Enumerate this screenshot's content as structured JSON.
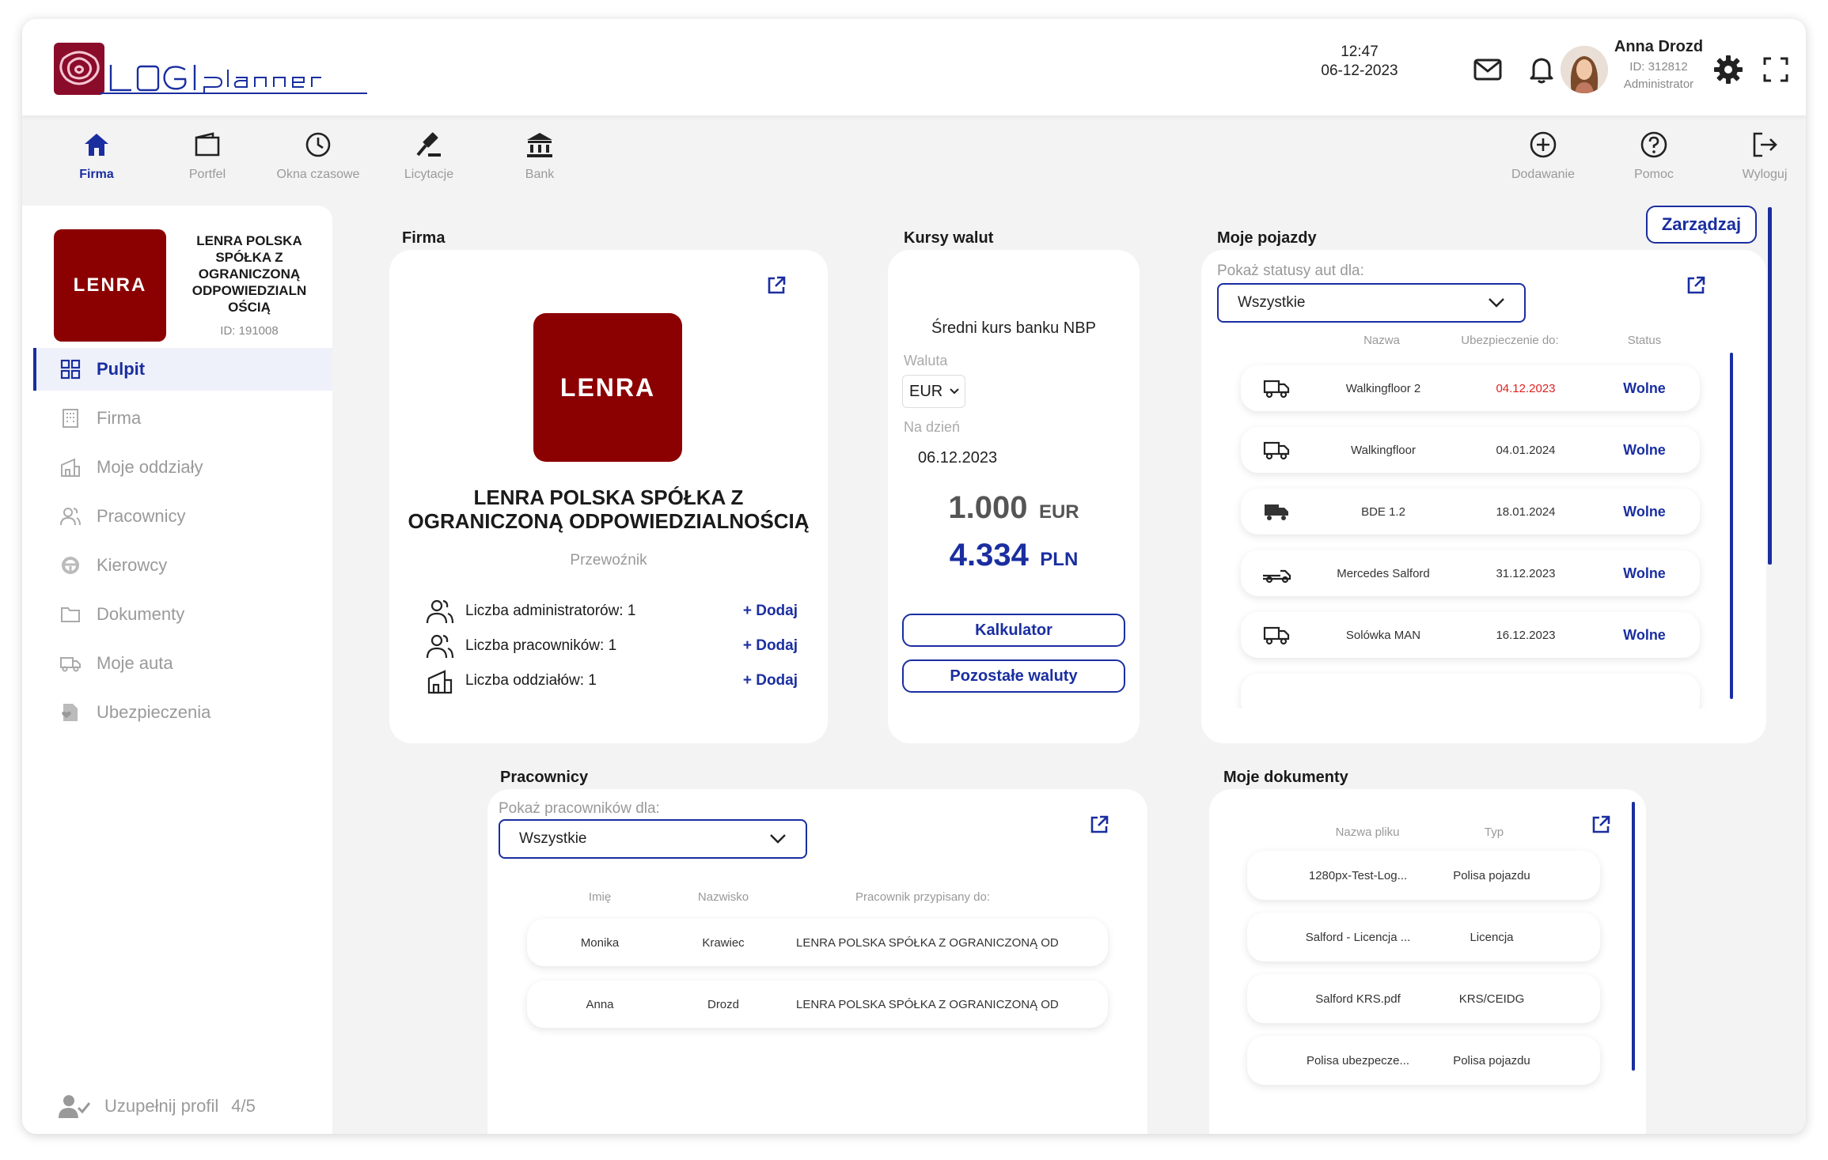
{
  "header": {
    "time": "12:47",
    "date": "06-12-2023",
    "user": {
      "name": "Anna Drozd",
      "id": "ID: 312812",
      "role": "Administrator"
    }
  },
  "nav": {
    "left": [
      {
        "label": "Firma",
        "icon": "home-icon",
        "active": true
      },
      {
        "label": "Portfel",
        "icon": "wallet-icon"
      },
      {
        "label": "Okna czasowe",
        "icon": "clock-icon"
      },
      {
        "label": "Licytacje",
        "icon": "gavel-icon"
      },
      {
        "label": "Bank",
        "icon": "bank-icon"
      }
    ],
    "right": [
      {
        "label": "Dodawanie",
        "icon": "plus-circle-icon"
      },
      {
        "label": "Pomoc",
        "icon": "help-icon"
      },
      {
        "label": "Wyloguj",
        "icon": "logout-icon"
      }
    ]
  },
  "sidebar": {
    "logo_text": "LENRA",
    "company_name": "LENRA POLSKA SPÓŁKA Z OGRANICZONĄ ODPOWIEDZIALN OŚCIĄ",
    "company_id": "ID: 191008",
    "items": [
      {
        "label": "Pulpit",
        "icon": "dashboard-icon",
        "active": true
      },
      {
        "label": "Firma",
        "icon": "building-icon"
      },
      {
        "label": "Moje oddziały",
        "icon": "branch-icon"
      },
      {
        "label": "Pracownicy",
        "icon": "users-icon"
      },
      {
        "label": "Kierowcy",
        "icon": "steering-wheel-icon"
      },
      {
        "label": "Dokumenty",
        "icon": "folder-icon"
      },
      {
        "label": "Moje auta",
        "icon": "truck-icon"
      },
      {
        "label": "Ubezpieczenia",
        "icon": "insurance-icon"
      }
    ],
    "complete_profile": "Uzupełnij profil",
    "profile_progress": "4/5"
  },
  "firma": {
    "title": "Firma",
    "logo_text": "LENRA",
    "name": "LENRA POLSKA SPÓŁKA Z OGRANICZONĄ ODPOWIEDZIALNOŚCIĄ",
    "type": "Przewoźnik",
    "stats": [
      {
        "label": "Liczba administratorów: 1",
        "action": "+ Dodaj"
      },
      {
        "label": "Liczba pracowników: 1",
        "action": "+ Dodaj"
      },
      {
        "label": "Liczba oddziałów: 1",
        "action": "+ Dodaj"
      }
    ]
  },
  "kursy": {
    "title": "Kursy walut",
    "subtitle": "Średni kurs banku NBP",
    "currency_label": "Waluta",
    "currency": "EUR",
    "date_label": "Na dzień",
    "date": "06.12.2023",
    "amount": "1.000",
    "amount_unit": "EUR",
    "result": "4.334",
    "result_unit": "PLN",
    "calc_btn": "Kalkulator",
    "other_btn": "Pozostałe waluty"
  },
  "pojazdy": {
    "title": "Moje pojazdy",
    "manage_btn": "Zarządzaj",
    "filter_label": "Pokaż statusy aut dla:",
    "filter_value": "Wszystkie",
    "columns": [
      "Nazwa",
      "Ubezpieczenie do:",
      "Status"
    ],
    "rows": [
      {
        "name": "Walkingfloor 2",
        "insurance": "04.12.2023",
        "status": "Wolne",
        "icon": "truck-icon",
        "expired": true
      },
      {
        "name": "Walkingfloor",
        "insurance": "04.01.2024",
        "status": "Wolne",
        "icon": "truck-icon"
      },
      {
        "name": "BDE 1.2",
        "insurance": "18.01.2024",
        "status": "Wolne",
        "icon": "truck-filled-icon"
      },
      {
        "name": "Mercedes Salford",
        "insurance": "31.12.2023",
        "status": "Wolne",
        "icon": "trailer-icon"
      },
      {
        "name": "Solówka MAN",
        "insurance": "16.12.2023",
        "status": "Wolne",
        "icon": "truck-icon"
      }
    ]
  },
  "pracownicy": {
    "title": "Pracownicy",
    "filter_label": "Pokaż pracowników dla:",
    "filter_value": "Wszystkie",
    "columns": [
      "Imię",
      "Nazwisko",
      "Pracownik przypisany do:"
    ],
    "rows": [
      {
        "first": "Monika",
        "last": "Krawiec",
        "assigned": "LENRA POLSKA SPÓŁKA Z OGRANICZONĄ OD"
      },
      {
        "first": "Anna",
        "last": "Drozd",
        "assigned": "LENRA POLSKA SPÓŁKA Z OGRANICZONĄ OD"
      }
    ]
  },
  "dokumenty": {
    "title": "Moje dokumenty",
    "columns": [
      "Nazwa pliku",
      "Typ"
    ],
    "rows": [
      {
        "file": "1280px-Test-Log...",
        "type": "Polisa pojazdu"
      },
      {
        "file": "Salford - Licencja ...",
        "type": "Licencja"
      },
      {
        "file": "Salford KRS.pdf",
        "type": "KRS/CEIDG"
      },
      {
        "file": "Polisa ubezpecze...",
        "type": "Polisa pojazdu"
      }
    ]
  },
  "colors": {
    "brand": "#1a2ea0",
    "logo_red": "#8b0000",
    "alert": "#e02020"
  }
}
